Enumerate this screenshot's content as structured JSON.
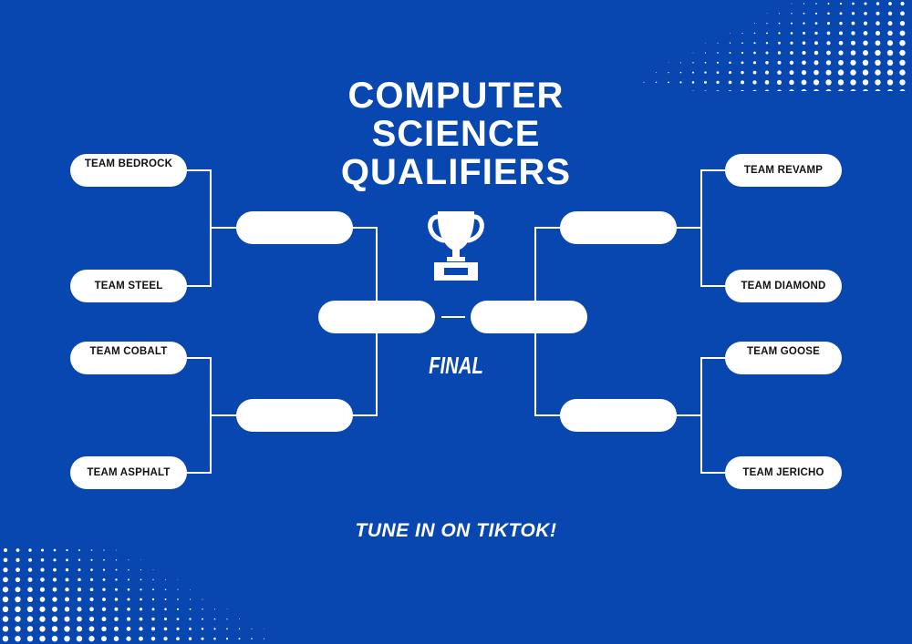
{
  "title": {
    "line1": "COMPUTER",
    "line2": "SCIENCE",
    "line3": "QUALIFIERS"
  },
  "left_teams": [
    "TEAM BEDROCK",
    "TEAM STEEL",
    "TEAM COBALT",
    "TEAM ASPHALT"
  ],
  "right_teams": [
    "TEAM REVAMP",
    "TEAM DIAMOND",
    "TEAM GOOSE",
    "TEAM JERICHO"
  ],
  "final_label": "FINAL",
  "footer": "TUNE IN ON TIKTOK!",
  "icons": {
    "trophy": "trophy-icon"
  },
  "colors": {
    "background": "#0846b0",
    "slot": "#ffffff",
    "text_dark": "#111111"
  }
}
